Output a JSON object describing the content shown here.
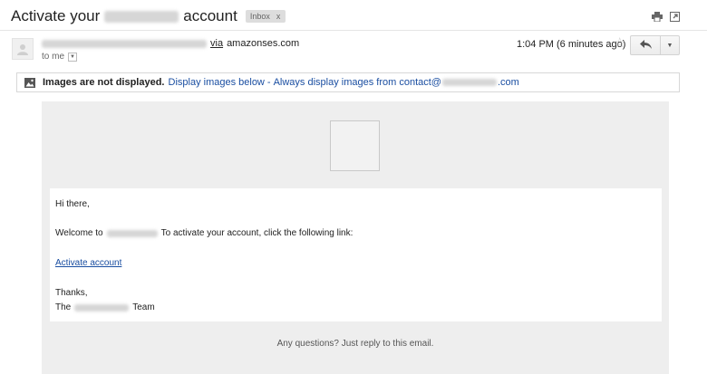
{
  "header": {
    "subject_before": "Activate your",
    "subject_after": "account",
    "label_tag": "Inbox",
    "label_close": "x"
  },
  "message": {
    "via_label": "via",
    "via_domain": "amazonses.com",
    "recipient": "to me",
    "time": "1:04 PM (6 minutes ago)",
    "star": "☆",
    "more_caret": "▼",
    "dropdown_caret": "▼"
  },
  "images_notice": {
    "bold": "Images are not displayed.",
    "display_below": "Display images below",
    "separator": "-",
    "always_prefix": "Always display images from contact@",
    "always_suffix": ".com"
  },
  "body": {
    "greeting": "Hi there,",
    "welcome_prefix": "Welcome to",
    "welcome_suffix": "To activate your account, click the following link:",
    "activate_link": "Activate account",
    "thanks": "Thanks,",
    "sign_prefix": "The",
    "sign_suffix": "Team",
    "footer": "Any questions? Just reply to this email."
  },
  "icons": {
    "print": "print-icon",
    "new_window": "new-window-icon",
    "avatar": "avatar-icon",
    "reply": "reply-icon",
    "image": "image-icon"
  },
  "colors": {
    "link": "#1a4ea1",
    "body_bg": "#eeeeee",
    "tag_bg": "#dddddd"
  }
}
